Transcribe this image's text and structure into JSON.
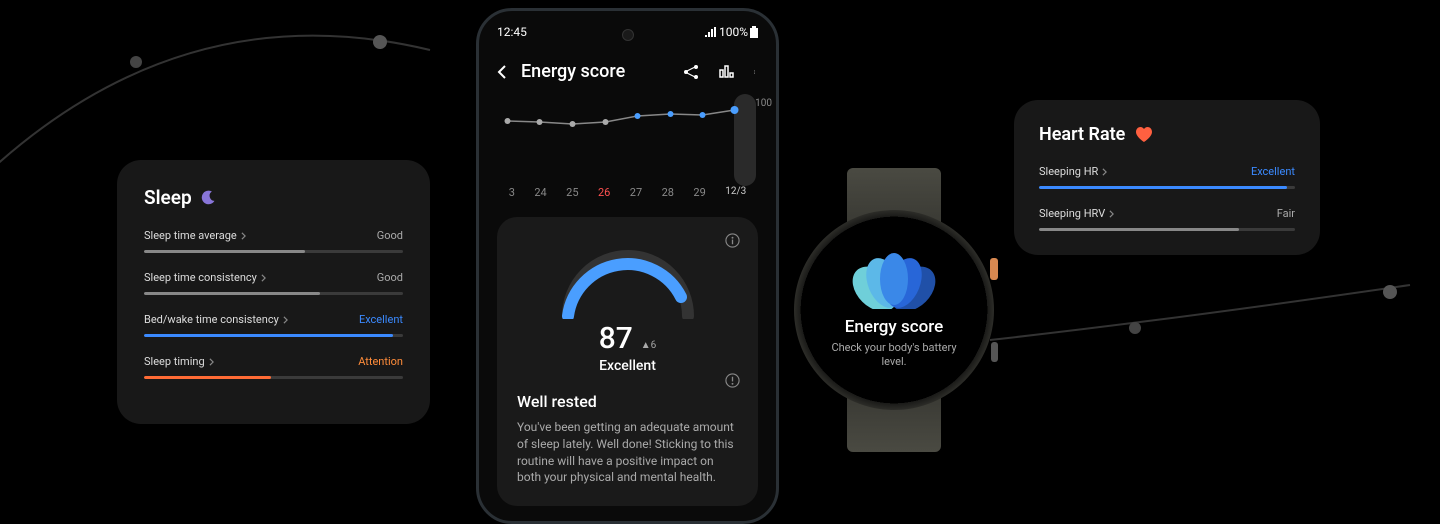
{
  "sleep": {
    "title": "Sleep",
    "metrics": [
      {
        "label": "Sleep time average",
        "value": "Good",
        "valueClass": "good",
        "fillClass": "gray",
        "fillPct": 62
      },
      {
        "label": "Sleep time consistency",
        "value": "Good",
        "valueClass": "good",
        "fillClass": "gray",
        "fillPct": 68
      },
      {
        "label": "Bed/wake time consistency",
        "value": "Excellent",
        "valueClass": "excellent",
        "fillClass": "blue",
        "fillPct": 96
      },
      {
        "label": "Sleep timing",
        "value": "Attention",
        "valueClass": "attention",
        "fillClass": "orange",
        "fillPct": 49
      }
    ]
  },
  "phone": {
    "time": "12:45",
    "battery": "100%",
    "title": "Energy score",
    "axisMax": "100",
    "dates": [
      "3",
      "24",
      "25",
      "26",
      "27",
      "28",
      "29",
      "12/3"
    ],
    "score": "87",
    "delta": "6",
    "scoreLabel": "Excellent",
    "restedTitle": "Well rested",
    "restedText": "You've been getting an adequate amount of sleep lately. Well done! Sticking to this routine will have a positive impact on both your physical and mental health."
  },
  "watch": {
    "title": "Energy score",
    "subtitle": "Check your body's battery level."
  },
  "heartRate": {
    "title": "Heart Rate",
    "metrics": [
      {
        "label": "Sleeping HR",
        "value": "Excellent",
        "valueClass": "excellent",
        "fillClass": "blue",
        "fillPct": 97
      },
      {
        "label": "Sleeping HRV",
        "value": "Fair",
        "valueClass": "fair",
        "fillClass": "gray",
        "fillPct": 78
      }
    ]
  },
  "chart_data": {
    "type": "line",
    "title": "Energy score",
    "categories": [
      "3",
      "24",
      "25",
      "26",
      "27",
      "28",
      "29",
      "12/3"
    ],
    "values": [
      74,
      72,
      70,
      73,
      80,
      83,
      82,
      87
    ],
    "ylim": [
      0,
      100
    ],
    "xlabel": "",
    "ylabel": ""
  }
}
